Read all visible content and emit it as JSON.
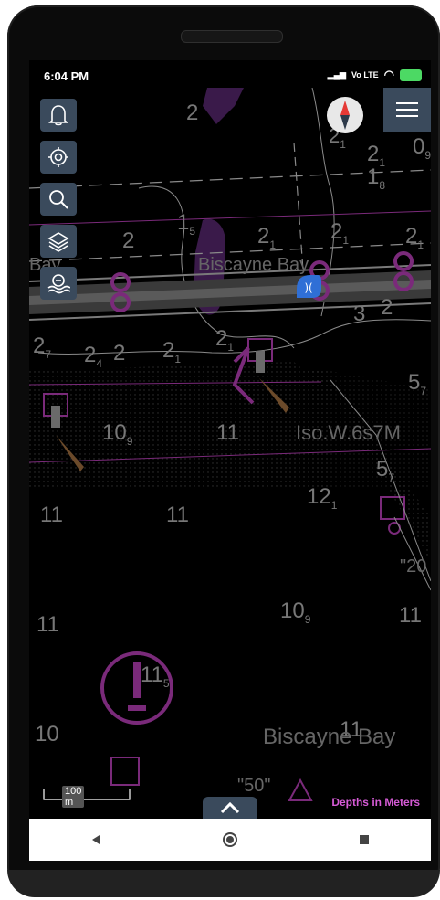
{
  "status_bar": {
    "time": "6:04 PM",
    "network": "LTE",
    "volte": "Vo"
  },
  "map": {
    "soundings": [
      {
        "text": "2",
        "sub": ""
      },
      {
        "text": "2",
        "sub": "1"
      },
      {
        "text": "2",
        "sub": "1"
      },
      {
        "text": "1",
        "sub": "8"
      },
      {
        "text": "0",
        "sub": "9"
      },
      {
        "text": "1",
        "sub": "5"
      },
      {
        "text": "2",
        "sub": ""
      },
      {
        "text": "2",
        "sub": "1"
      },
      {
        "text": "2",
        "sub": "1"
      },
      {
        "text": "2",
        "sub": "1"
      },
      {
        "text": "2",
        "sub": "7"
      },
      {
        "text": "2",
        "sub": "4"
      },
      {
        "text": "2",
        "sub": ""
      },
      {
        "text": "2",
        "sub": "1"
      },
      {
        "text": "2",
        "sub": "1"
      },
      {
        "text": "3",
        "sub": ""
      },
      {
        "text": "2",
        "sub": ""
      },
      {
        "text": "5",
        "sub": "7"
      },
      {
        "text": "10",
        "sub": "9"
      },
      {
        "text": "11",
        "sub": ""
      },
      {
        "text": "5",
        "sub": "7"
      },
      {
        "text": "11",
        "sub": ""
      },
      {
        "text": "11",
        "sub": ""
      },
      {
        "text": "12",
        "sub": "1"
      },
      {
        "text": "10",
        "sub": "9"
      },
      {
        "text": "11",
        "sub": ""
      },
      {
        "text": "11",
        "sub": ""
      },
      {
        "text": "11",
        "sub": "5"
      },
      {
        "text": "10",
        "sub": ""
      },
      {
        "text": "11",
        "sub": ""
      }
    ],
    "labels": {
      "biscayne_upper": "Biscayne Bay",
      "bay_left": "Bay",
      "light_char": "Iso.W.6s7M",
      "biscayne_lower": "Biscayne Bay",
      "quote_20": "\"20",
      "quote_50": "\"50\""
    }
  },
  "toolbar": {
    "alarm_icon": "bell-icon",
    "gps_icon": "locate-icon",
    "search_icon": "search-icon",
    "layers_icon": "layers-icon",
    "depth_icon": "depth-icon",
    "menu_icon": "hamburger-icon",
    "compass_icon": "compass-icon"
  },
  "scale_bar": {
    "label": "100 m"
  },
  "depth_units": {
    "label": "Depths in Meters"
  },
  "nav": {
    "back_icon": "back-triangle-icon",
    "home_icon": "home-circle-icon",
    "recents_icon": "recents-square-icon"
  },
  "colors": {
    "chart_magenta": "#7a2a7a",
    "sounding_white": "#8a8a8a",
    "button_bg": "#3a4a5c",
    "nav_bar_bg": "#ffffff"
  }
}
